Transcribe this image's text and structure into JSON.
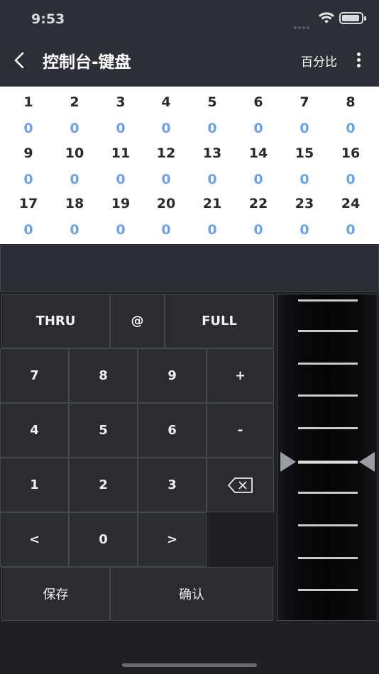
{
  "status": {
    "time": "9:53"
  },
  "header": {
    "title": "控制台-键盘",
    "mode_label": "百分比"
  },
  "channels": [
    {
      "num": "1",
      "val": "0"
    },
    {
      "num": "2",
      "val": "0"
    },
    {
      "num": "3",
      "val": "0"
    },
    {
      "num": "4",
      "val": "0"
    },
    {
      "num": "5",
      "val": "0"
    },
    {
      "num": "6",
      "val": "0"
    },
    {
      "num": "7",
      "val": "0"
    },
    {
      "num": "8",
      "val": "0"
    },
    {
      "num": "9",
      "val": "0"
    },
    {
      "num": "10",
      "val": "0"
    },
    {
      "num": "11",
      "val": "0"
    },
    {
      "num": "12",
      "val": "0"
    },
    {
      "num": "13",
      "val": "0"
    },
    {
      "num": "14",
      "val": "0"
    },
    {
      "num": "15",
      "val": "0"
    },
    {
      "num": "16",
      "val": "0"
    },
    {
      "num": "17",
      "val": "0"
    },
    {
      "num": "18",
      "val": "0"
    },
    {
      "num": "19",
      "val": "0"
    },
    {
      "num": "20",
      "val": "0"
    },
    {
      "num": "21",
      "val": "0"
    },
    {
      "num": "22",
      "val": "0"
    },
    {
      "num": "23",
      "val": "0"
    },
    {
      "num": "24",
      "val": "0"
    }
  ],
  "keypad": {
    "thru": "THRU",
    "at": "@",
    "full": "FULL",
    "k7": "7",
    "k8": "8",
    "k9": "9",
    "plus": "+",
    "k4": "4",
    "k5": "5",
    "k6": "6",
    "minus": "-",
    "k1": "1",
    "k2": "2",
    "k3": "3",
    "lt": "<",
    "k0": "0",
    "gt": ">",
    "save": "保存",
    "confirm": "确认"
  },
  "colors": {
    "value_blue": "#6ea2e6",
    "panel": "#2a2c32",
    "border": "#45474e"
  }
}
